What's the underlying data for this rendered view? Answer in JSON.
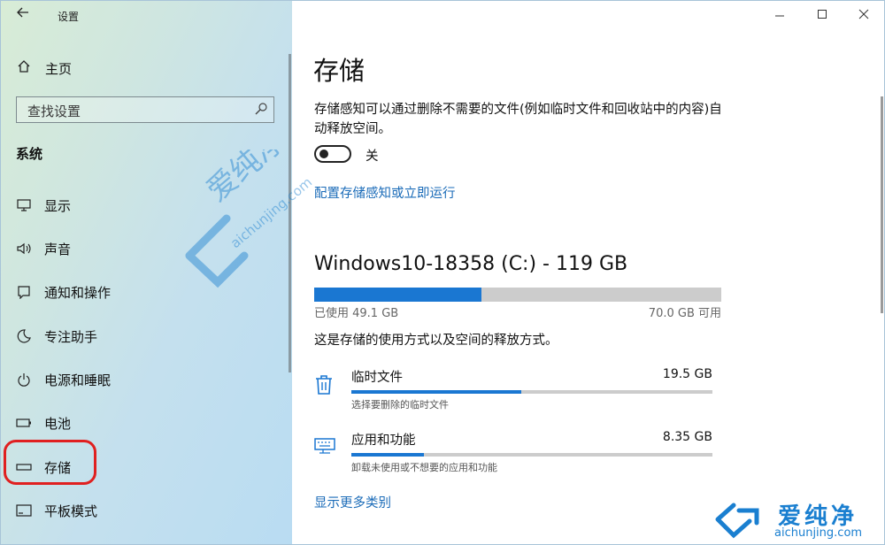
{
  "window": {
    "app_title": "设置",
    "controls": [
      "—",
      "☐",
      "✕"
    ]
  },
  "sidebar": {
    "home_label": "主页",
    "search_placeholder": "查找设置",
    "section_title": "系统",
    "items": [
      {
        "label": "显示",
        "icon": "monitor-icon"
      },
      {
        "label": "声音",
        "icon": "speaker-icon"
      },
      {
        "label": "通知和操作",
        "icon": "notification-icon"
      },
      {
        "label": "专注助手",
        "icon": "moon-icon"
      },
      {
        "label": "电源和睡眠",
        "icon": "power-icon"
      },
      {
        "label": "电池",
        "icon": "battery-icon"
      },
      {
        "label": "存储",
        "icon": "storage-icon",
        "selected": true
      },
      {
        "label": "平板模式",
        "icon": "tablet-icon"
      }
    ]
  },
  "main": {
    "title": "存储",
    "description": "存储感知可以通过删除不需要的文件(例如临时文件和回收站中的内容)自动释放空间。",
    "toggle_label": "关",
    "toggle_on": false,
    "config_link": "配置存储感知或立即运行",
    "drive": {
      "title": "Windows10-18358 (C:) - 119 GB",
      "used_label": "已使用 49.1 GB",
      "available_label": "70.0 GB 可用",
      "used_fraction": 0.41
    },
    "drive_description": "这是存储的使用方式以及空间的释放方式。",
    "categories": [
      {
        "name": "临时文件",
        "size": "19.5 GB",
        "subtitle": "选择要删除的临时文件",
        "fraction": 0.47,
        "icon": "trash-icon"
      },
      {
        "name": "应用和功能",
        "size": "8.35 GB",
        "subtitle": "卸载未使用或不想要的应用和功能",
        "fraction": 0.2,
        "icon": "keyboard-icon"
      }
    ],
    "more_link": "显示更多类别"
  },
  "watermark": {
    "text": "爱纯净",
    "url": "aichunjing.com"
  },
  "colors": {
    "accent": "#1a77d2",
    "link": "#1a6bb8",
    "highlight": "#e02020"
  }
}
